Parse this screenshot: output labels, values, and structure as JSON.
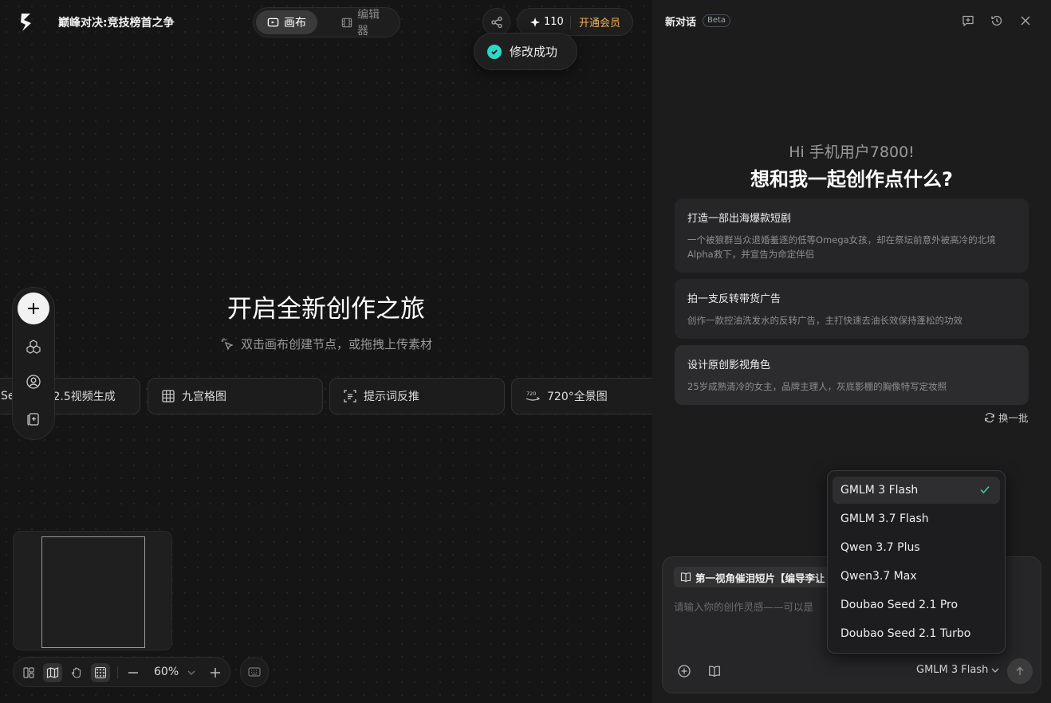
{
  "header": {
    "project_title": "巅峰对决:竞技榜首之争",
    "tabs": [
      {
        "label": "画布",
        "active": true
      },
      {
        "label": "编辑器",
        "active": false
      }
    ],
    "credits": "110",
    "vip_label": "开通会员"
  },
  "toast": {
    "text": "修改成功"
  },
  "canvas": {
    "title": "开启全新创作之旅",
    "hint": "双击画布创建节点，或拖拽上传素材",
    "chips": [
      "Se",
      "2.5视频生成",
      "九宫格图",
      "提示词反推",
      "720°全景图"
    ],
    "zoom": "60%"
  },
  "panel": {
    "title": "新对话",
    "badge": "Beta",
    "greeting": "Hi 手机用户7800!",
    "question": "想和我一起创作点什么?",
    "suggestions": [
      {
        "title": "打造一部出海爆款短剧",
        "desc": "一个被狼群当众退婚羞逐的低等Omega女孩，却在祭坛前意外被高冷的北境Alpha救下，并宣告为命定伴侣"
      },
      {
        "title": "拍一支反转带货广告",
        "desc": "创作一款控油洗发水的反转广告，主打快速去油长效保持蓬松的功效"
      },
      {
        "title": "设计原创影视角色",
        "desc": "25岁成熟清冷的女主，品牌主理人，灰底影棚的胸像特写定妆照"
      }
    ],
    "refresh_label": "换一批",
    "ref_chip": "第一视角催泪短片【编导李让",
    "prompt_placeholder": "请输入你的创作灵感——可以是",
    "model_selected": "GMLM 3 Flash",
    "model_options": [
      "GMLM 3 Flash",
      "GMLM 3.7 Flash",
      "Qwen 3.7 Plus",
      "Qwen3.7 Max",
      "Doubao Seed 2.1 Pro",
      "Doubao Seed 2.1 Turbo"
    ]
  },
  "colors": {
    "accent_teal": "#2fd8c6",
    "vip_gold": "#f2b24a",
    "panel_bg": "#1c1c1d",
    "canvas_bg": "#151515"
  }
}
